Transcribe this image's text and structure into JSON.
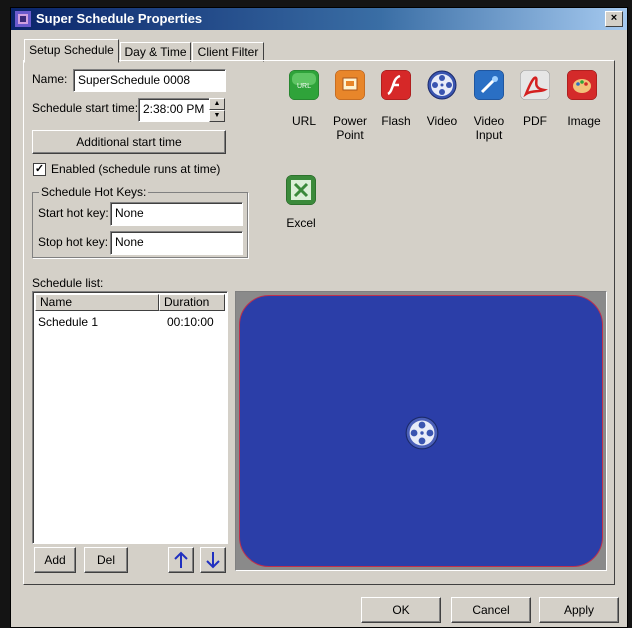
{
  "window": {
    "title": "Super Schedule Properties",
    "close_label": "×"
  },
  "tabs": [
    {
      "label": "Setup Schedule",
      "active": true
    },
    {
      "label": "Day & Time",
      "active": false
    },
    {
      "label": "Client Filter",
      "active": false
    }
  ],
  "form": {
    "name_label": "Name:",
    "name_value": "SuperSchedule 0008",
    "start_time_label": "Schedule start time:",
    "start_time_value": "2:38:00 PM",
    "additional_start_label": "Additional start time",
    "enabled_label": "Enabled (schedule runs at time)",
    "enabled_checked": true,
    "hotkeys_group_label": "Schedule Hot Keys:",
    "start_hotkey_label": "Start hot key:",
    "start_hotkey_value": "None",
    "stop_hotkey_label": "Stop hot key:",
    "stop_hotkey_value": "None"
  },
  "media_types": [
    {
      "label": "URL",
      "icon": "url-icon",
      "color": "#2fa33a"
    },
    {
      "label": "Power Point",
      "icon": "powerpoint-icon",
      "color": "#e8862a"
    },
    {
      "label": "Flash",
      "icon": "flash-icon",
      "color": "#d62828"
    },
    {
      "label": "Video",
      "icon": "video-reel-icon",
      "color": "#3a55b0"
    },
    {
      "label": "Video Input",
      "icon": "video-input-icon",
      "color": "#2a6fc4"
    },
    {
      "label": "PDF",
      "icon": "pdf-icon",
      "color": "#d0d0d0"
    },
    {
      "label": "Image",
      "icon": "image-palette-icon",
      "color": "#d42a2a"
    },
    {
      "label": "Excel",
      "icon": "excel-icon",
      "color": "#3b8a3b"
    }
  ],
  "schedule_list": {
    "label": "Schedule list:",
    "columns": [
      "Name",
      "Duration"
    ],
    "rows": [
      {
        "name": "Schedule 1",
        "duration": "00:10:00"
      }
    ],
    "add_label": "Add",
    "del_label": "Del",
    "up_label": "🡑",
    "down_label": "🡓"
  },
  "footer": {
    "ok_label": "OK",
    "cancel_label": "Cancel",
    "apply_label": "Apply"
  },
  "colors": {
    "preview_screen": "#2b3ea8",
    "preview_border": "#c0304c",
    "titlebar": "#0a246a"
  }
}
